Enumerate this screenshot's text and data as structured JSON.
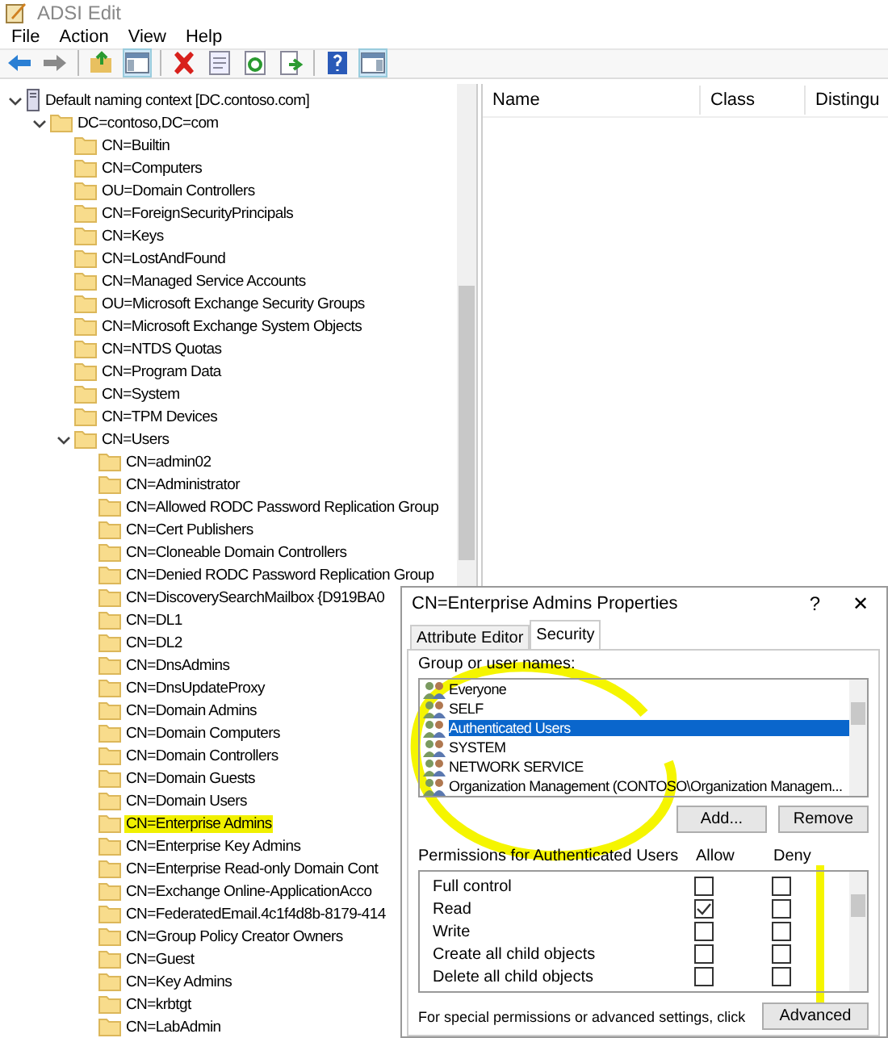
{
  "window": {
    "title": "ADSI Edit"
  },
  "menu": [
    "File",
    "Action",
    "View",
    "Help"
  ],
  "tree": [
    {
      "label": "Default naming context [DC.contoso.com]",
      "kind": "server",
      "expanded": true,
      "highlighted": false,
      "children": [
        {
          "label": "DC=contoso,DC=com",
          "kind": "folder",
          "expanded": true,
          "highlighted": false,
          "children": [
            {
              "label": "CN=Builtin",
              "kind": "folder",
              "highlighted": false
            },
            {
              "label": "CN=Computers",
              "kind": "folder",
              "highlighted": false
            },
            {
              "label": "OU=Domain Controllers",
              "kind": "folder",
              "highlighted": false
            },
            {
              "label": "CN=ForeignSecurityPrincipals",
              "kind": "folder",
              "highlighted": false
            },
            {
              "label": "CN=Keys",
              "kind": "folder",
              "highlighted": false
            },
            {
              "label": "CN=LostAndFound",
              "kind": "folder",
              "highlighted": false
            },
            {
              "label": "CN=Managed Service Accounts",
              "kind": "folder",
              "highlighted": false
            },
            {
              "label": "OU=Microsoft Exchange Security Groups",
              "kind": "folder",
              "highlighted": false
            },
            {
              "label": "CN=Microsoft Exchange System Objects",
              "kind": "folder",
              "highlighted": false
            },
            {
              "label": "CN=NTDS Quotas",
              "kind": "folder",
              "highlighted": false
            },
            {
              "label": "CN=Program Data",
              "kind": "folder",
              "highlighted": false
            },
            {
              "label": "CN=System",
              "kind": "folder",
              "highlighted": false
            },
            {
              "label": "CN=TPM Devices",
              "kind": "folder",
              "highlighted": false
            },
            {
              "label": "CN=Users",
              "kind": "folder",
              "expanded": true,
              "highlighted": false,
              "children": [
                {
                  "label": "CN=admin02",
                  "kind": "folder",
                  "highlighted": false
                },
                {
                  "label": "CN=Administrator",
                  "kind": "folder",
                  "highlighted": false
                },
                {
                  "label": "CN=Allowed RODC Password Replication Group",
                  "kind": "folder",
                  "highlighted": false
                },
                {
                  "label": "CN=Cert Publishers",
                  "kind": "folder",
                  "highlighted": false
                },
                {
                  "label": "CN=Cloneable Domain Controllers",
                  "kind": "folder",
                  "highlighted": false
                },
                {
                  "label": "CN=Denied RODC Password Replication Group",
                  "kind": "folder",
                  "highlighted": false
                },
                {
                  "label": "CN=DiscoverySearchMailbox {D919BA0",
                  "kind": "folder",
                  "highlighted": false
                },
                {
                  "label": "CN=DL1",
                  "kind": "folder",
                  "highlighted": false
                },
                {
                  "label": "CN=DL2",
                  "kind": "folder",
                  "highlighted": false
                },
                {
                  "label": "CN=DnsAdmins",
                  "kind": "folder",
                  "highlighted": false
                },
                {
                  "label": "CN=DnsUpdateProxy",
                  "kind": "folder",
                  "highlighted": false
                },
                {
                  "label": "CN=Domain Admins",
                  "kind": "folder",
                  "highlighted": false
                },
                {
                  "label": "CN=Domain Computers",
                  "kind": "folder",
                  "highlighted": false
                },
                {
                  "label": "CN=Domain Controllers",
                  "kind": "folder",
                  "highlighted": false
                },
                {
                  "label": "CN=Domain Guests",
                  "kind": "folder",
                  "highlighted": false
                },
                {
                  "label": "CN=Domain Users",
                  "kind": "folder",
                  "highlighted": false
                },
                {
                  "label": "CN=Enterprise Admins",
                  "kind": "folder",
                  "highlighted": true
                },
                {
                  "label": "CN=Enterprise Key Admins",
                  "kind": "folder",
                  "highlighted": false
                },
                {
                  "label": "CN=Enterprise Read-only Domain Cont",
                  "kind": "folder",
                  "highlighted": false
                },
                {
                  "label": "CN=Exchange Online-ApplicationAcco",
                  "kind": "folder",
                  "highlighted": false
                },
                {
                  "label": "CN=FederatedEmail.4c1f4d8b-8179-414",
                  "kind": "folder",
                  "highlighted": false
                },
                {
                  "label": "CN=Group Policy Creator Owners",
                  "kind": "folder",
                  "highlighted": false
                },
                {
                  "label": "CN=Guest",
                  "kind": "folder",
                  "highlighted": false
                },
                {
                  "label": "CN=Key Admins",
                  "kind": "folder",
                  "highlighted": false
                },
                {
                  "label": "CN=krbtgt",
                  "kind": "folder",
                  "highlighted": false
                },
                {
                  "label": "CN=LabAdmin",
                  "kind": "folder",
                  "highlighted": false
                }
              ]
            }
          ]
        }
      ]
    }
  ],
  "list": {
    "columns": [
      "Name",
      "Class",
      "Distingu"
    ]
  },
  "dialog": {
    "title": "CN=Enterprise Admins Properties",
    "help": "?",
    "close": "✕",
    "tabs": [
      {
        "label": "Attribute Editor",
        "selected": false
      },
      {
        "label": "Security",
        "selected": true
      }
    ],
    "group_label": "Group or user names:",
    "users": [
      {
        "name": "Everyone",
        "selected": false
      },
      {
        "name": "SELF",
        "selected": false
      },
      {
        "name": "Authenticated Users",
        "selected": true
      },
      {
        "name": "SYSTEM",
        "selected": false
      },
      {
        "name": "NETWORK SERVICE",
        "selected": false
      },
      {
        "name": "Organization Management (CONTOSO\\Organization Managem...",
        "selected": false
      }
    ],
    "buttons": [
      "Add...",
      "Remove"
    ],
    "permissions_label": "Permissions for Authenticated Users",
    "allow_label": "Allow",
    "deny_label": "Deny",
    "permissions": [
      {
        "name": "Full control",
        "allow": false,
        "deny": false
      },
      {
        "name": "Read",
        "allow": true,
        "deny": false
      },
      {
        "name": "Write",
        "allow": false,
        "deny": false
      },
      {
        "name": "Create all child objects",
        "allow": false,
        "deny": false
      },
      {
        "name": "Delete all child objects",
        "allow": false,
        "deny": false
      }
    ],
    "footer": "For special permissions or advanced settings, click",
    "advanced": "Advanced"
  }
}
